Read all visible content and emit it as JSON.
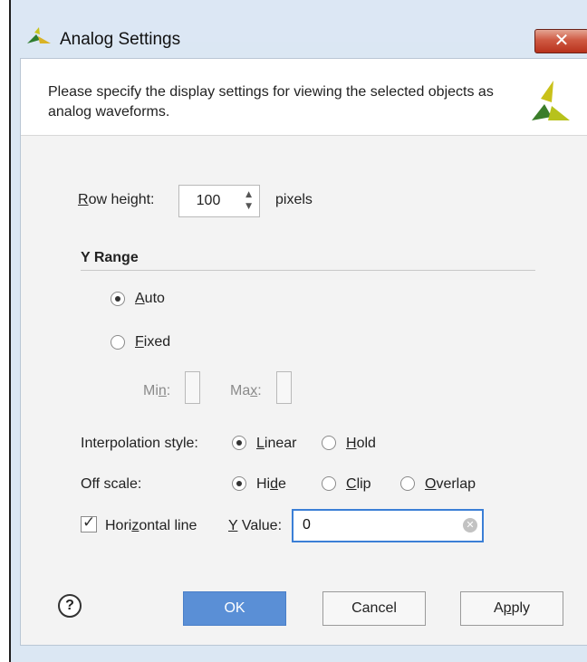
{
  "window": {
    "title": "Analog Settings",
    "close_label": "✕"
  },
  "header": {
    "description": "Please specify the display settings for viewing the selected objects as analog waveforms."
  },
  "row_height": {
    "label_pre": "",
    "label_mnemonic": "R",
    "label_post": "ow height:",
    "value": "100",
    "unit": "pixels"
  },
  "y_range": {
    "title": "Y Range",
    "auto": {
      "mnemonic": "A",
      "rest": "uto",
      "selected": true
    },
    "fixed": {
      "mnemonic": "F",
      "rest": "ixed",
      "selected": false
    },
    "min": {
      "pre": "Mi",
      "mnemonic": "n",
      "post": ":"
    },
    "max": {
      "pre": "Ma",
      "mnemonic": "x",
      "post": ":"
    }
  },
  "interpolation": {
    "label": "Interpolation style:",
    "linear": {
      "mnemonic": "L",
      "rest": "inear",
      "selected": true
    },
    "hold": {
      "mnemonic": "H",
      "rest": "old",
      "selected": false
    }
  },
  "off_scale": {
    "label": "Off scale:",
    "hide": {
      "pre": "Hi",
      "mnemonic": "d",
      "post": "e",
      "selected": true
    },
    "clip": {
      "mnemonic": "C",
      "rest": "lip",
      "selected": false
    },
    "overlap": {
      "mnemonic": "O",
      "rest": "verlap",
      "selected": false
    }
  },
  "horizontal_line": {
    "pre": "Hori",
    "mnemonic": "z",
    "post": "ontal line",
    "checked": true,
    "y_value_mnemonic": "Y",
    "y_value_rest": " Value:",
    "y_value": "0"
  },
  "buttons": {
    "help": "?",
    "ok": "OK",
    "cancel": "Cancel",
    "apply_pre": "A",
    "apply_mnemonic": "p",
    "apply_post": "ply"
  },
  "colors": {
    "ok_button": "#5a8fd6",
    "focus_border": "#3b7fd6",
    "logo_yellow": "#c9c11a",
    "logo_green": "#3a7d2a"
  }
}
